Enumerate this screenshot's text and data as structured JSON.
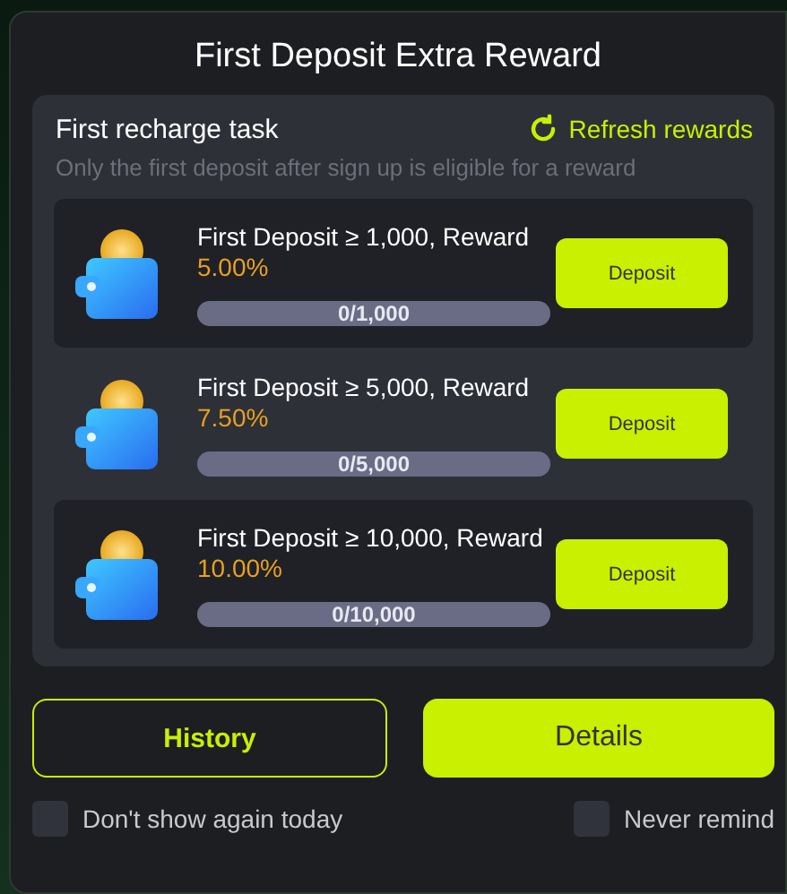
{
  "title": "First Deposit Extra Reward",
  "task": {
    "heading": "First recharge task",
    "refresh": "Refresh rewards",
    "note": "Only the first deposit after sign up is eligible for a reward"
  },
  "rows": [
    {
      "label": "First Deposit ≥ 1,000, Reward",
      "reward": "5.00%",
      "progress": "0/1,000",
      "button": "Deposit"
    },
    {
      "label": "First Deposit ≥ 5,000, Reward",
      "reward": "7.50%",
      "progress": "0/5,000",
      "button": "Deposit"
    },
    {
      "label": "First Deposit ≥ 10,000, Reward",
      "reward": "10.00%",
      "progress": "0/10,000",
      "button": "Deposit"
    }
  ],
  "buttons": {
    "history": "History",
    "details": "Details"
  },
  "options": [
    {
      "label": "Don't show again today",
      "checked": false
    },
    {
      "label": "Never remind",
      "checked": false
    }
  ]
}
